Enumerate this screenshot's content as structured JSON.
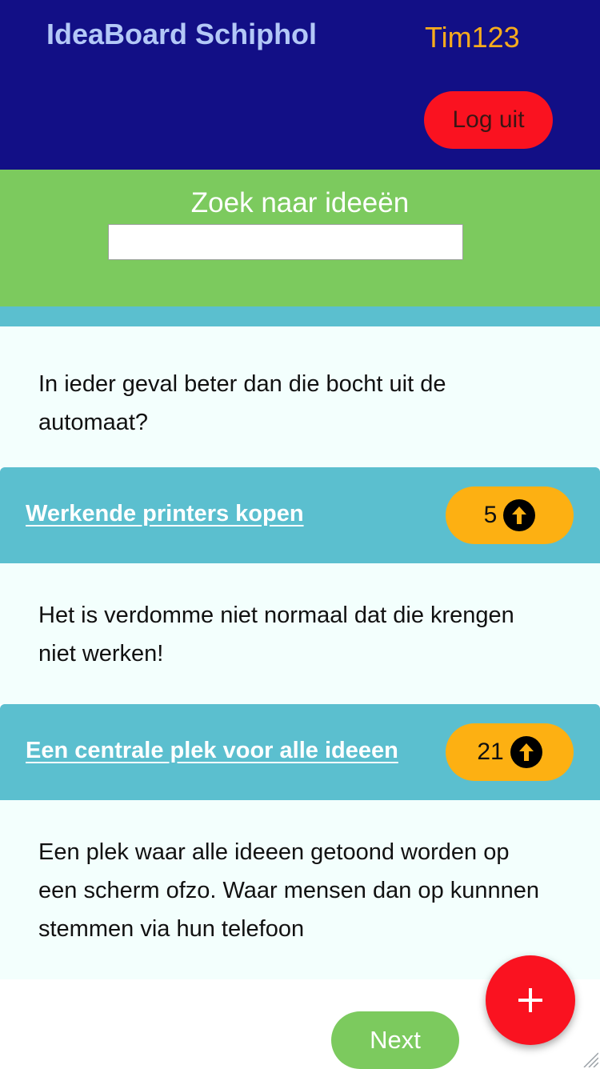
{
  "header": {
    "title": "IdeaBoard Schiphol",
    "username": "Tim123",
    "logout_label": "Log uit"
  },
  "search": {
    "label": "Zoek naar ideeën",
    "value": "",
    "placeholder": ""
  },
  "ideas": [
    {
      "description": "In ieder geval beter dan die bocht uit de automaat?"
    },
    {
      "title": "Werkende printers kopen",
      "votes": "5",
      "description": "Het is verdomme niet normaal dat die krengen niet werken!"
    },
    {
      "title": "Een centrale plek voor alle ideeen",
      "votes": "21",
      "description": "Een plek waar alle ideeen getoond worden op een scherm ofzo. Waar mensen dan op kunnnen stemmen via hun telefoon"
    }
  ],
  "fab": {
    "label": "+"
  },
  "pagination": {
    "next_label": "Next"
  },
  "icons": {
    "vote": "arrow-up-circle-icon",
    "add": "plus-icon",
    "resize": "resize-grip-icon"
  },
  "colors": {
    "header_bg": "#120f86",
    "search_bg": "#7cca5e",
    "idea_header_bg": "#5bbfcf",
    "vote_bg": "#fdb012",
    "danger": "#fa1220"
  }
}
